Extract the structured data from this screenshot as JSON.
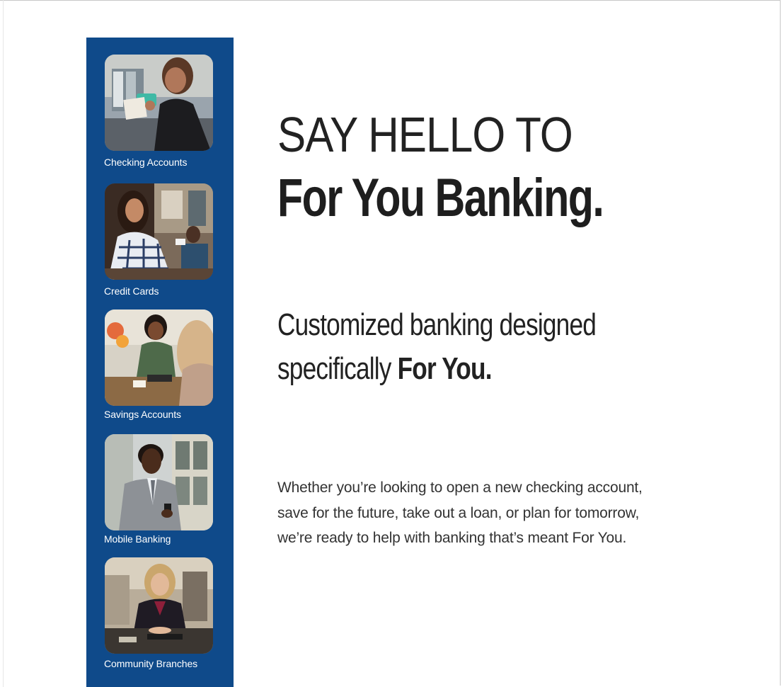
{
  "sidebar": {
    "background": "#0f4a8a",
    "items": [
      {
        "label": "Checking Accounts",
        "image": "woman-with-phone-photo"
      },
      {
        "label": "Credit Cards",
        "image": "woman-at-counter-photo"
      },
      {
        "label": "Savings Accounts",
        "image": "teller-with-customer-photo"
      },
      {
        "label": "Mobile Banking",
        "image": "man-with-phone-photo"
      },
      {
        "label": "Community Branches",
        "image": "banker-at-desk-photo"
      }
    ]
  },
  "hero": {
    "line1": "SAY HELLO TO",
    "line2": "For You Banking."
  },
  "subheading": {
    "line1": "Customized banking designed",
    "line2_prefix": "specifically ",
    "line2_bold": "For You."
  },
  "body": {
    "paragraph": "Whether you’re looking to open a new checking account, save for the future, take out a loan, or plan for tomorrow, we’re ready to help with banking that’s meant For You."
  }
}
